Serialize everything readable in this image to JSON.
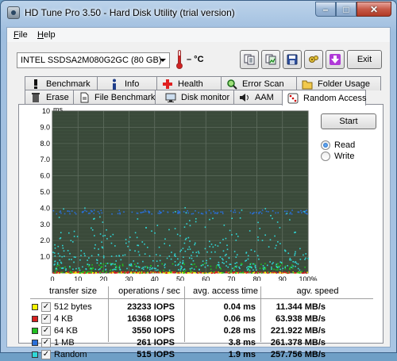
{
  "window": {
    "title": "HD Tune Pro 3.50 - Hard Disk Utility (trial version)",
    "buttons": {
      "minimize": "–",
      "maximize": "□",
      "close": "✕"
    }
  },
  "menu": {
    "file": "File",
    "help": "Help"
  },
  "toolbar": {
    "drive": "INTEL SSDSA2M080G2GC (80 GB)",
    "temperature": "– °C",
    "exit": "Exit",
    "icons": [
      "copy-text-icon",
      "copy-image-icon",
      "save-icon",
      "options-icon",
      "download-icon"
    ]
  },
  "tabs": {
    "row1": [
      {
        "label": "Benchmark",
        "icon": "exclamation-icon"
      },
      {
        "label": "Info",
        "icon": "info-icon"
      },
      {
        "label": "Health",
        "icon": "health-cross-icon"
      },
      {
        "label": "Error Scan",
        "icon": "magnifier-icon"
      },
      {
        "label": "Folder Usage",
        "icon": "folder-icon"
      }
    ],
    "row2": [
      {
        "label": "Erase",
        "icon": "trash-icon"
      },
      {
        "label": "File Benchmark",
        "icon": "file-icon"
      },
      {
        "label": "Disk monitor",
        "icon": "monitor-icon"
      },
      {
        "label": "AAM",
        "icon": "speaker-icon"
      },
      {
        "label": "Random Access",
        "icon": "dice-icon",
        "active": true
      }
    ]
  },
  "controls": {
    "start": "Start",
    "mode_options": [
      "Read",
      "Write"
    ],
    "selected_mode": "Read"
  },
  "chart_data": {
    "type": "scatter",
    "ylabel": "ms",
    "y_ticks": [
      "1.0",
      "2.0",
      "3.0",
      "4.0",
      "5.0",
      "6.0",
      "7.0",
      "8.0",
      "9.0",
      "10"
    ],
    "x_ticks": [
      "0",
      "10",
      "20",
      "30",
      "40",
      "50",
      "60",
      "70",
      "80",
      "90",
      "100%"
    ],
    "xlim": [
      0,
      100
    ],
    "ylim": [
      0,
      10
    ],
    "grid": true,
    "background": "#3a4a3a",
    "series": [
      {
        "name": "512 bytes",
        "color": "#f4f400",
        "approx_access_ms": 0.04
      },
      {
        "name": "4 KB",
        "color": "#d62020",
        "approx_access_ms": 0.06
      },
      {
        "name": "64 KB",
        "color": "#20c020",
        "approx_access_ms": 0.28
      },
      {
        "name": "1 MB",
        "color": "#2a6fd8",
        "approx_access_ms": 3.8
      },
      {
        "name": "Random",
        "color": "#30d8d8",
        "approx_access_ms": 1.9
      }
    ]
  },
  "results": {
    "headers": [
      "transfer size",
      "operations / sec",
      "avg. access time",
      "agv. speed"
    ],
    "rows": [
      {
        "name": "512 bytes",
        "ops": "23233 IOPS",
        "access": "0.04 ms",
        "speed": "11.344 MB/s",
        "color": "#f4f400"
      },
      {
        "name": "4 KB",
        "ops": "16368 IOPS",
        "access": "0.06 ms",
        "speed": "63.938 MB/s",
        "color": "#d62020"
      },
      {
        "name": "64 KB",
        "ops": "3550 IOPS",
        "access": "0.28 ms",
        "speed": "221.922 MB/s",
        "color": "#20c020"
      },
      {
        "name": "1 MB",
        "ops": "261 IOPS",
        "access": "3.8 ms",
        "speed": "261.378 MB/s",
        "color": "#2a6fd8"
      },
      {
        "name": "Random",
        "ops": "515 IOPS",
        "access": "1.9 ms",
        "speed": "257.756 MB/s",
        "color": "#30d8d8"
      }
    ]
  }
}
